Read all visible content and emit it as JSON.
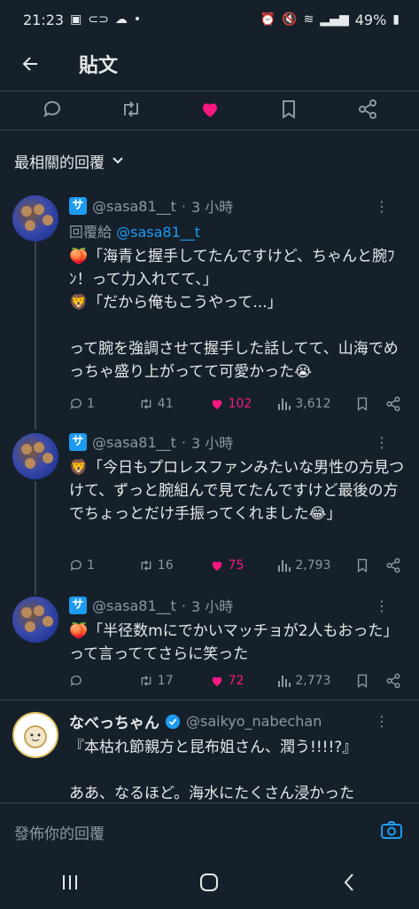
{
  "status": {
    "time": "21:23",
    "battery": "49%"
  },
  "header": {
    "title": "貼文"
  },
  "sort": {
    "label": "最相關的回覆"
  },
  "tweets": [
    {
      "handle": "@sasa81__t",
      "time": "3 小時",
      "reply_prefix": "回覆給",
      "reply_handle": "@sasa81__t",
      "text": "🍑「海青と握手してたんですけど、ちゃんと腕ﾌﾝ！って力入れてて、」\n🦁「だから俺もこうやって...」\n\nって腕を強調させて握手した話してて、山海でめっちゃ盛り上がってて可愛かった😭",
      "replies": "1",
      "retweets": "41",
      "likes": "102",
      "views": "3,612"
    },
    {
      "handle": "@sasa81__t",
      "time": "3 小時",
      "text": "🦁「今日もプロレスファンみたいな男性の方見つけて、ずっと腕組んで見てたんですけど最後の方でちょっとだけ手振ってくれました😂」",
      "replies": "1",
      "retweets": "16",
      "likes": "75",
      "views": "2,793"
    },
    {
      "handle": "@sasa81__t",
      "time": "3 小時",
      "text": "🍑「半径数mにでかいマッチョが2人もおった」って言っててさらに笑った",
      "replies": "",
      "retweets": "17",
      "likes": "72",
      "views": "2,773"
    }
  ],
  "nabe": {
    "name": "なべっちゃん",
    "handle": "@saikyo_nabechan",
    "text": "『本枯れ節親方と昆布姐さん、潤う!!!!?』\n\nああ、なるほど。海水にたくさん浸かった"
  },
  "reply_box": {
    "placeholder": "發佈你的回覆"
  }
}
